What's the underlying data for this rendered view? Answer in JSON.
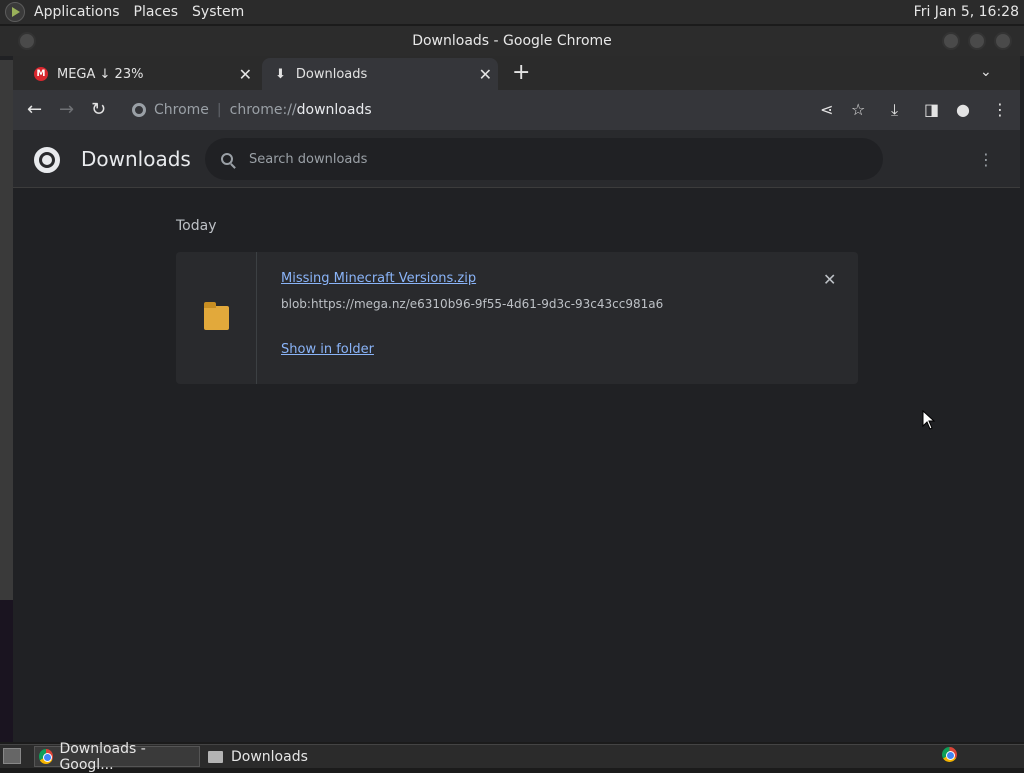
{
  "top_panel": {
    "menus": [
      "Applications",
      "Places",
      "System"
    ],
    "clock": "Fri Jan  5, 16:28"
  },
  "window": {
    "title": "Downloads - Google Chrome"
  },
  "tabs": [
    {
      "label": "MEGA ↓ 23%",
      "favicon": "M"
    },
    {
      "label": "Downloads"
    }
  ],
  "omnibox": {
    "site_label": "Chrome",
    "url_prefix": "chrome://",
    "url_path": "downloads"
  },
  "page": {
    "title": "Downloads",
    "search_placeholder": "Search downloads",
    "section": "Today",
    "download": {
      "file_name": "Missing Minecraft Versions.zip",
      "url": "blob:https://mega.nz/e6310b96-9f55-4d61-9d3c-93c43cc981a6",
      "action": "Show in folder"
    }
  },
  "taskbar": {
    "items": [
      "Downloads - Googl...",
      "Downloads"
    ]
  }
}
